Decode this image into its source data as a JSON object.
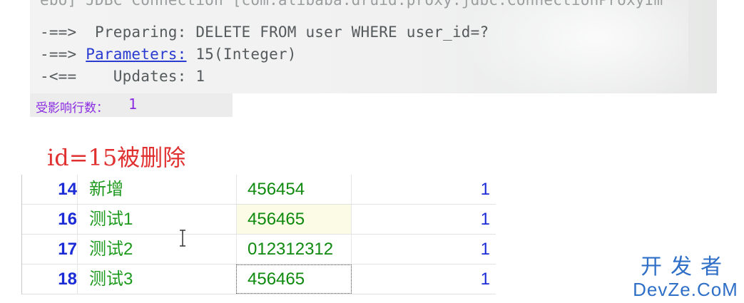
{
  "console": {
    "cut_line": "ebo] JDBC Connection [com.alibaba.druid.proxy.jdbc.ConnectionProxyIm",
    "line1": "-==>  Preparing: DELETE FROM user WHERE user_id=?",
    "line2_prefix": "-==> ",
    "line2_link": "Parameters:",
    "line2_suffix": " 15(Integer)",
    "line3": "-<==    Updates: 1"
  },
  "result": {
    "label": "受影响行数：",
    "value": "1"
  },
  "annotation": "id=15被删除",
  "table": {
    "rows": [
      {
        "id": "14",
        "name": "新增",
        "pwd": "456454",
        "num": "1"
      },
      {
        "id": "16",
        "name": "测试1",
        "pwd": "456465",
        "num": "1"
      },
      {
        "id": "17",
        "name": "测试2",
        "pwd": "012312312",
        "num": "1"
      },
      {
        "id": "18",
        "name": "测试3",
        "pwd": "456465",
        "num": "1"
      }
    ]
  },
  "watermark": {
    "cn": "开发者",
    "en": "DevZe.CoM"
  },
  "colors": {
    "id_blue": "#1b2bd6",
    "text_green": "#1e9a1e",
    "annotation_red": "#e03030",
    "result_purple": "#8a2be2",
    "watermark_blue": "#2f6fc7"
  }
}
